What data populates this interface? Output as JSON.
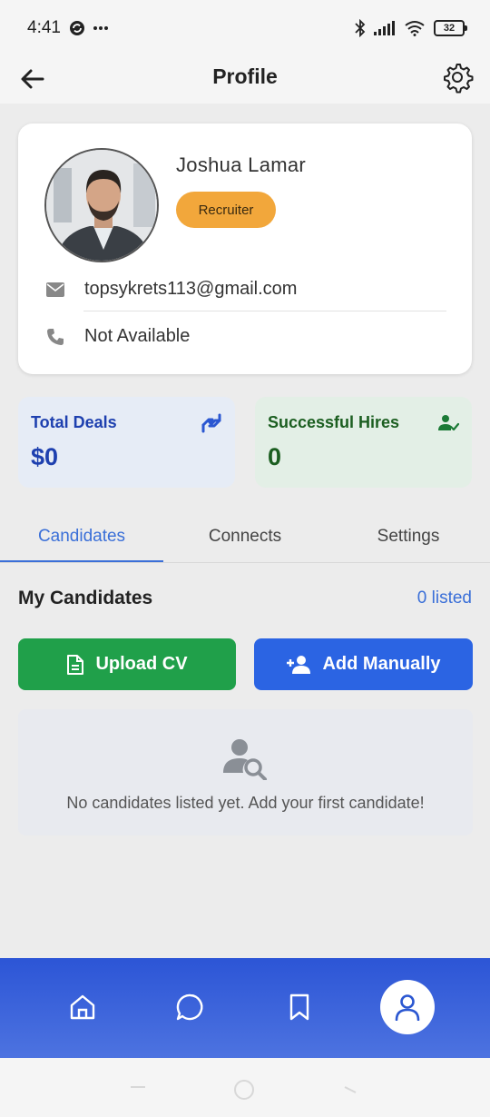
{
  "status_bar": {
    "time": "4:41",
    "battery_level": "32",
    "left_icons": [
      "sync-icon",
      "more-icon"
    ],
    "right_icons": [
      "bluetooth-icon",
      "signal-icon",
      "wifi-icon",
      "battery-icon"
    ]
  },
  "header": {
    "title": "Profile",
    "back_icon": "arrow-left-icon",
    "settings_icon": "gear-icon"
  },
  "profile": {
    "name": "Joshua Lamar",
    "role": "Recruiter",
    "email": "topsykrets113@gmail.com",
    "phone": "Not Available",
    "email_icon": "envelope-icon",
    "phone_icon": "phone-icon"
  },
  "stats": {
    "total_deals": {
      "label": "Total Deals",
      "value": "$0",
      "icon": "handshake-icon"
    },
    "successful_hires": {
      "label": "Successful Hires",
      "value": "0",
      "icon": "user-check-icon"
    }
  },
  "tabs": [
    {
      "label": "Candidates",
      "active": true
    },
    {
      "label": "Connects",
      "active": false
    },
    {
      "label": "Settings",
      "active": false
    }
  ],
  "candidates": {
    "title": "My Candidates",
    "listed": "0 listed",
    "upload_label": "Upload CV",
    "add_label": "Add Manually",
    "empty_message": "No candidates listed yet. Add your first candidate!"
  },
  "bottom_nav": {
    "items": [
      "home-icon",
      "chat-icon",
      "bookmark-icon",
      "profile-icon"
    ],
    "active": "profile-icon"
  },
  "colors": {
    "primary": "#2b64e3",
    "success": "#20a04a",
    "badge": "#f2a73b",
    "deals_text": "#1e40af",
    "hires_text": "#1b5e20"
  }
}
